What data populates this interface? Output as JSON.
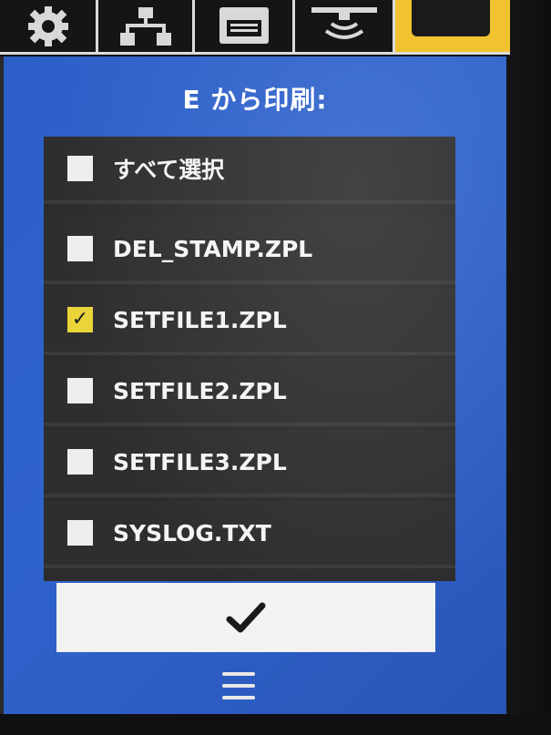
{
  "tabs": [
    {
      "icon": "gear-icon"
    },
    {
      "icon": "network-icon"
    },
    {
      "icon": "printer-icon"
    },
    {
      "icon": "sensor-icon"
    },
    {
      "icon": "active-tab"
    }
  ],
  "colors": {
    "screen_blue": "#2f63cc",
    "active_tab": "#f2c230",
    "checked_box": "#e9d43a"
  },
  "title": "E から印刷:",
  "list": {
    "items": [
      {
        "label": "すべて選択",
        "checked": false
      },
      {
        "label": "DEL_STAMP.ZPL",
        "checked": false
      },
      {
        "label": "SETFILE1.ZPL",
        "checked": true
      },
      {
        "label": "SETFILE2.ZPL",
        "checked": false
      },
      {
        "label": "SETFILE3.ZPL",
        "checked": false
      },
      {
        "label": "SYSLOG.TXT",
        "checked": false
      }
    ]
  },
  "confirm": {
    "icon": "checkmark-icon"
  },
  "menu": {
    "icon": "menu-icon"
  }
}
